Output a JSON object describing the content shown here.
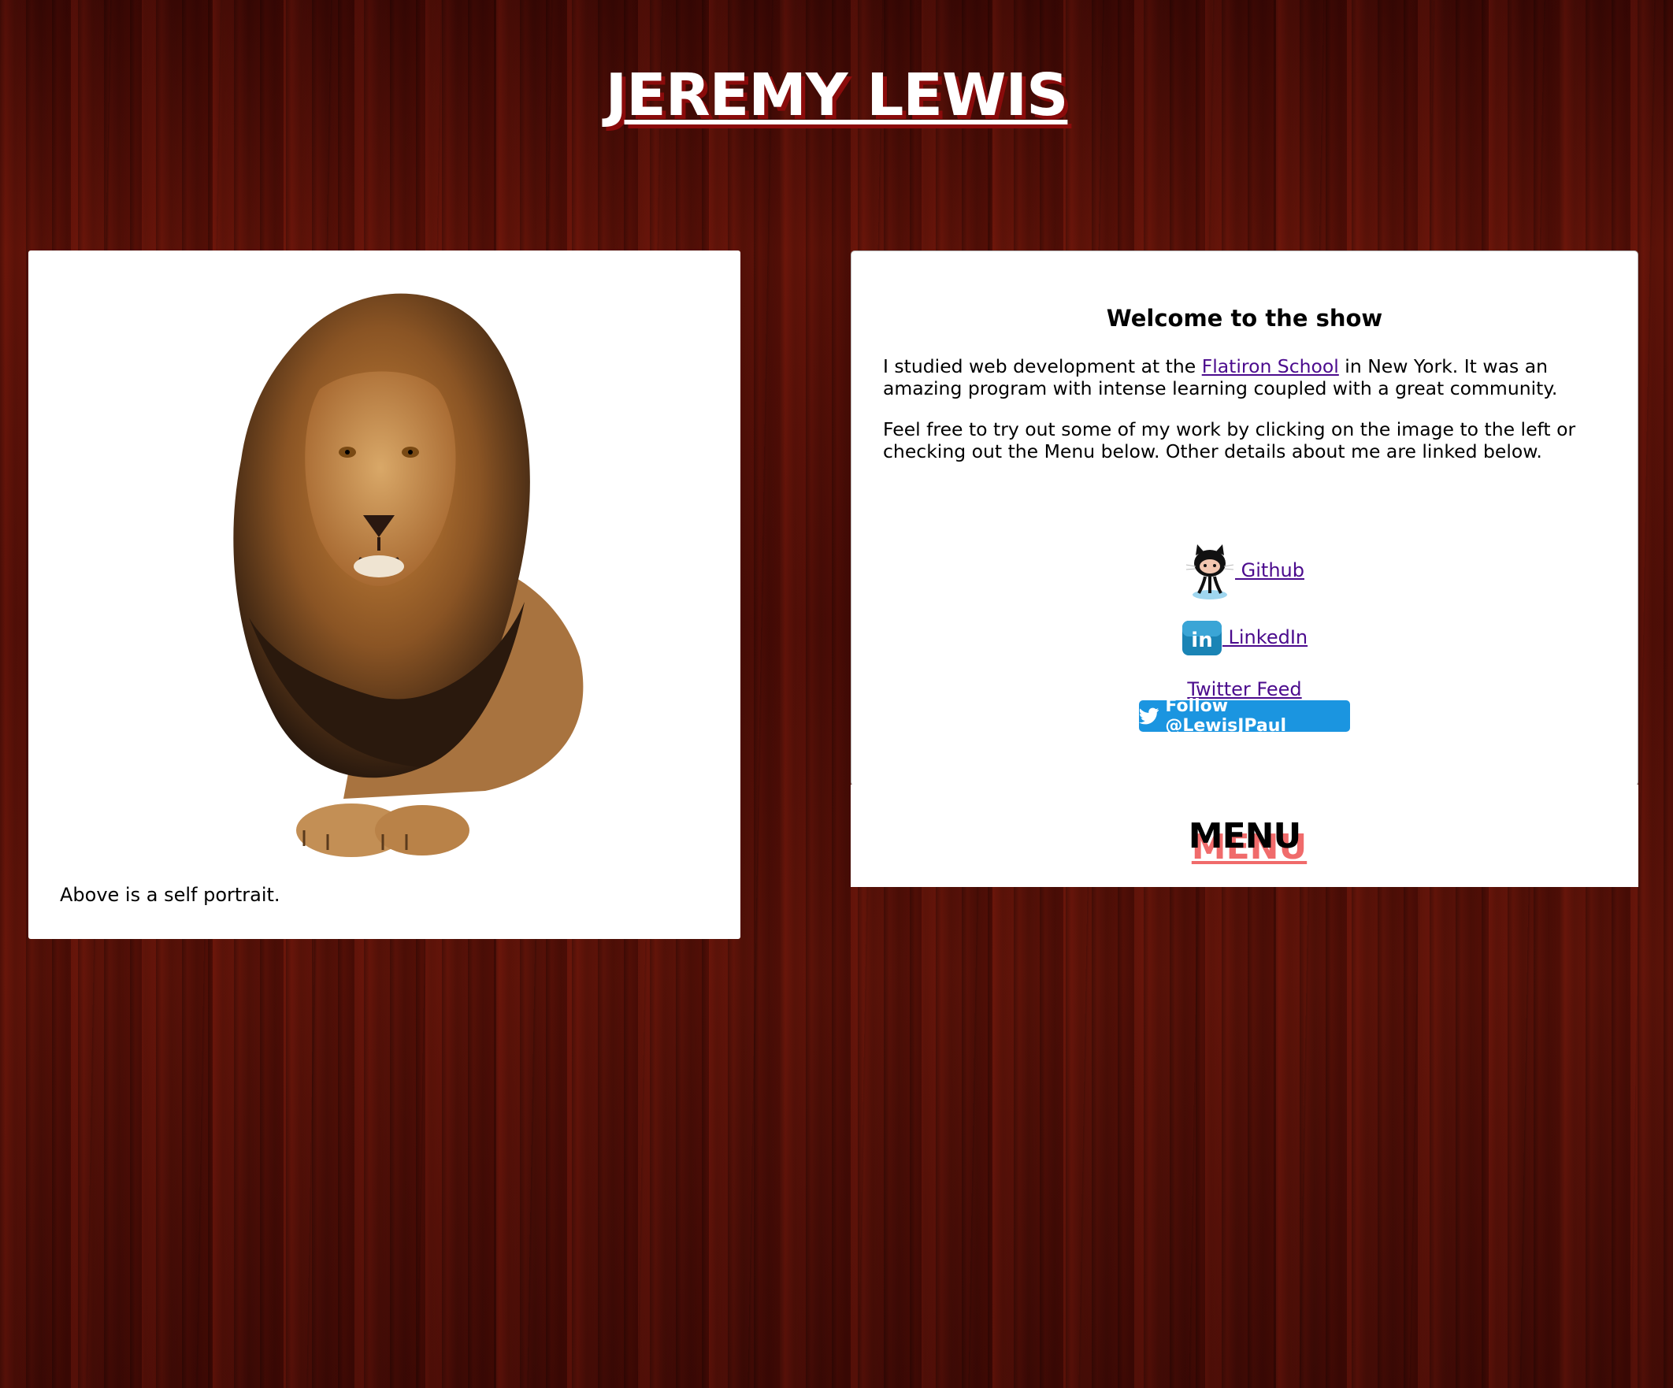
{
  "header": {
    "title": "JEREMY LEWIS"
  },
  "portrait": {
    "image": "lion-portrait",
    "caption": "Above is a self portrait."
  },
  "welcome": {
    "heading": "Welcome to the show",
    "para1_before": "I studied web development at the ",
    "para1_link": "Flatiron School",
    "para1_after": " in New York. It was an amazing program with intense learning coupled with a great community.",
    "para2": "Feel free to try out some of my work by clicking on the image to the left or checking out the Menu below. Other details about me are linked below."
  },
  "social": {
    "github_label": " Github",
    "linkedin_label": " LinkedIn",
    "twitter_label": "Twitter Feed",
    "follow_label": "Follow @LewisJPaul"
  },
  "menu": {
    "title": "MENU"
  },
  "colors": {
    "accent_shadow": "#8a0b0b",
    "link": "#4b0b8d",
    "twitter_blue": "#1b95e0",
    "menu_ghost": "#f06b6b"
  }
}
